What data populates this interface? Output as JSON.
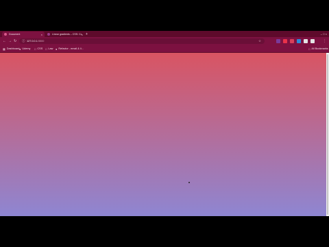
{
  "tabs": [
    {
      "title": "Document",
      "close": "×",
      "active": true
    },
    {
      "title": "Linear gradients – CSS: Casc",
      "close": "×",
      "active": false
    }
  ],
  "new_tab": "+",
  "window_controls": "–  □  ×",
  "toolbar": {
    "back_icon": "←",
    "forward_icon": "→",
    "reload_icon": "↻",
    "url_host": "127.0.0.1",
    "url_port": ":5500",
    "info_icon": "ⓘ",
    "star_icon": "☆",
    "menu_icon": "⋮"
  },
  "extensions": [
    {
      "name": "extension-1-icon",
      "color": "#7a3a9a"
    },
    {
      "name": "extension-2-icon",
      "color": "#e8324a"
    },
    {
      "name": "extension-3-icon",
      "color": "#d8405a"
    },
    {
      "name": "extension-4-icon",
      "color": "#2a8ad8"
    },
    {
      "name": "extension-5-icon",
      "color": "#e4e4e4"
    },
    {
      "name": "extension-6-icon",
      "color": "#e4e4e4"
    }
  ],
  "bookmarks": [
    {
      "icon": "▦",
      "label": "Dashboard"
    },
    {
      "icon": "●",
      "label": "Udemy"
    },
    {
      "icon": "□",
      "label": "CSS"
    },
    {
      "icon": "□",
      "label": "Law"
    },
    {
      "icon": "●",
      "label": "Refactor - email & li..."
    }
  ],
  "all_bookmarks": {
    "icon": "□",
    "label": "All Bookmarks"
  },
  "viewport": {
    "gradient_top": "#d95462",
    "gradient_bottom": "#8e86d2"
  },
  "colors": {
    "tabstrip": "#5e0a2b",
    "toolbar": "#7c1140"
  }
}
